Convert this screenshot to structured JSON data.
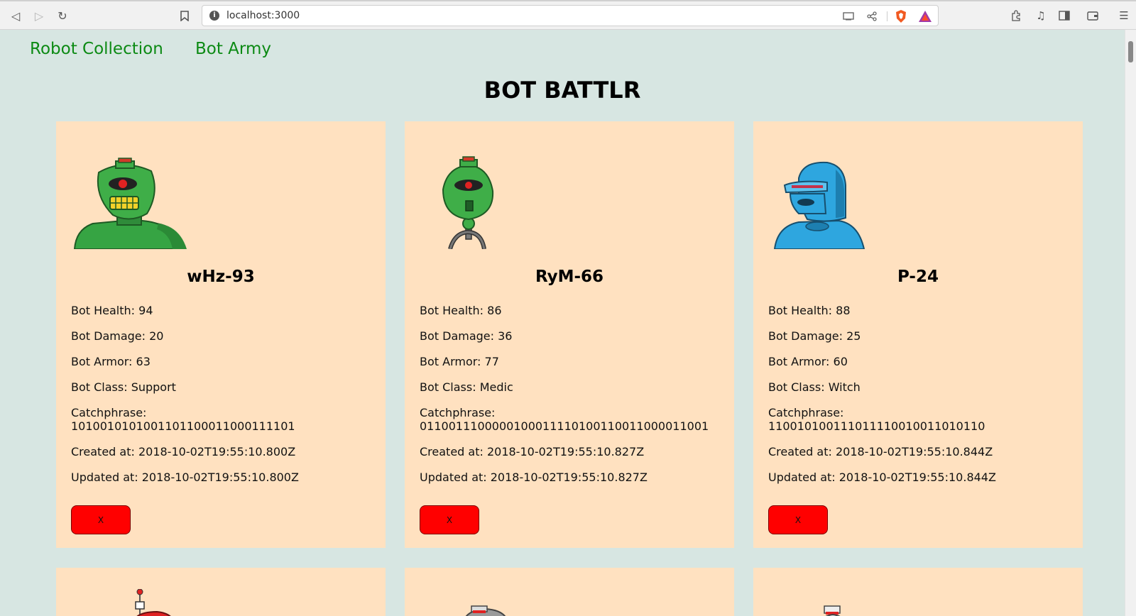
{
  "browser": {
    "url": "localhost:3000"
  },
  "nav": {
    "links": [
      "Robot Collection",
      "Bot Army"
    ]
  },
  "page_title": "BOT BATTLR",
  "bots": [
    {
      "name": "wHz-93",
      "health_label": "Bot Health: 94",
      "damage_label": "Bot Damage: 20",
      "armor_label": "Bot Armor: 63",
      "class_label": "Bot Class: Support",
      "catchphrase_label": "Catchphrase:",
      "catchphrase": "1010010101001101100011000111101",
      "created_label": "Created at: 2018-10-02T19:55:10.800Z",
      "updated_label": "Updated at: 2018-10-02T19:55:10.800Z",
      "delete_label": "X",
      "color": "#3fae48"
    },
    {
      "name": "RyM-66",
      "health_label": "Bot Health: 86",
      "damage_label": "Bot Damage: 36",
      "armor_label": "Bot Armor: 77",
      "class_label": "Bot Class: Medic",
      "catchphrase_label": "Catchphrase:",
      "catchphrase": "0110011100000100011110100110011000011001",
      "created_label": "Created at: 2018-10-02T19:55:10.827Z",
      "updated_label": "Updated at: 2018-10-02T19:55:10.827Z",
      "delete_label": "X",
      "color": "#3fae48"
    },
    {
      "name": "P-24",
      "health_label": "Bot Health: 88",
      "damage_label": "Bot Damage: 25",
      "armor_label": "Bot Armor: 60",
      "class_label": "Bot Class: Witch",
      "catchphrase_label": "Catchphrase:",
      "catchphrase": "11001010011101111001001101011​0",
      "created_label": "Created at: 2018-10-02T19:55:10.844Z",
      "updated_label": "Updated at: 2018-10-02T19:55:10.844Z",
      "delete_label": "X",
      "color": "#2ea6df"
    }
  ],
  "colors": {
    "page_bg": "#d7e6e2",
    "card_bg": "#ffe1c0",
    "link": "#0c8a14",
    "delete_button": "#ff0000"
  }
}
